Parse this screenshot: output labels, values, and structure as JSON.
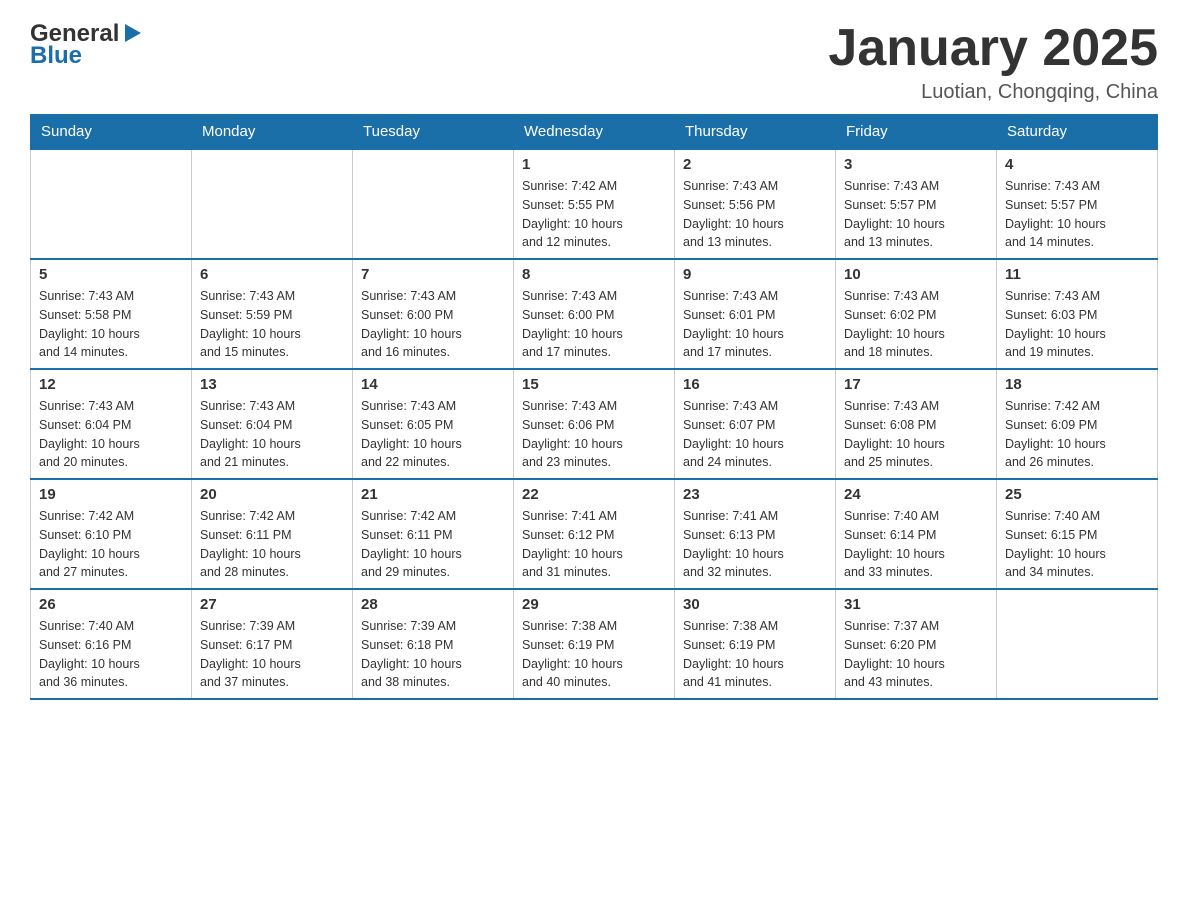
{
  "header": {
    "logo_general": "General",
    "logo_blue": "Blue",
    "month_title": "January 2025",
    "location": "Luotian, Chongqing, China"
  },
  "weekdays": [
    "Sunday",
    "Monday",
    "Tuesday",
    "Wednesday",
    "Thursday",
    "Friday",
    "Saturday"
  ],
  "weeks": [
    [
      {
        "day": "",
        "info": ""
      },
      {
        "day": "",
        "info": ""
      },
      {
        "day": "",
        "info": ""
      },
      {
        "day": "1",
        "info": "Sunrise: 7:42 AM\nSunset: 5:55 PM\nDaylight: 10 hours\nand 12 minutes."
      },
      {
        "day": "2",
        "info": "Sunrise: 7:43 AM\nSunset: 5:56 PM\nDaylight: 10 hours\nand 13 minutes."
      },
      {
        "day": "3",
        "info": "Sunrise: 7:43 AM\nSunset: 5:57 PM\nDaylight: 10 hours\nand 13 minutes."
      },
      {
        "day": "4",
        "info": "Sunrise: 7:43 AM\nSunset: 5:57 PM\nDaylight: 10 hours\nand 14 minutes."
      }
    ],
    [
      {
        "day": "5",
        "info": "Sunrise: 7:43 AM\nSunset: 5:58 PM\nDaylight: 10 hours\nand 14 minutes."
      },
      {
        "day": "6",
        "info": "Sunrise: 7:43 AM\nSunset: 5:59 PM\nDaylight: 10 hours\nand 15 minutes."
      },
      {
        "day": "7",
        "info": "Sunrise: 7:43 AM\nSunset: 6:00 PM\nDaylight: 10 hours\nand 16 minutes."
      },
      {
        "day": "8",
        "info": "Sunrise: 7:43 AM\nSunset: 6:00 PM\nDaylight: 10 hours\nand 17 minutes."
      },
      {
        "day": "9",
        "info": "Sunrise: 7:43 AM\nSunset: 6:01 PM\nDaylight: 10 hours\nand 17 minutes."
      },
      {
        "day": "10",
        "info": "Sunrise: 7:43 AM\nSunset: 6:02 PM\nDaylight: 10 hours\nand 18 minutes."
      },
      {
        "day": "11",
        "info": "Sunrise: 7:43 AM\nSunset: 6:03 PM\nDaylight: 10 hours\nand 19 minutes."
      }
    ],
    [
      {
        "day": "12",
        "info": "Sunrise: 7:43 AM\nSunset: 6:04 PM\nDaylight: 10 hours\nand 20 minutes."
      },
      {
        "day": "13",
        "info": "Sunrise: 7:43 AM\nSunset: 6:04 PM\nDaylight: 10 hours\nand 21 minutes."
      },
      {
        "day": "14",
        "info": "Sunrise: 7:43 AM\nSunset: 6:05 PM\nDaylight: 10 hours\nand 22 minutes."
      },
      {
        "day": "15",
        "info": "Sunrise: 7:43 AM\nSunset: 6:06 PM\nDaylight: 10 hours\nand 23 minutes."
      },
      {
        "day": "16",
        "info": "Sunrise: 7:43 AM\nSunset: 6:07 PM\nDaylight: 10 hours\nand 24 minutes."
      },
      {
        "day": "17",
        "info": "Sunrise: 7:43 AM\nSunset: 6:08 PM\nDaylight: 10 hours\nand 25 minutes."
      },
      {
        "day": "18",
        "info": "Sunrise: 7:42 AM\nSunset: 6:09 PM\nDaylight: 10 hours\nand 26 minutes."
      }
    ],
    [
      {
        "day": "19",
        "info": "Sunrise: 7:42 AM\nSunset: 6:10 PM\nDaylight: 10 hours\nand 27 minutes."
      },
      {
        "day": "20",
        "info": "Sunrise: 7:42 AM\nSunset: 6:11 PM\nDaylight: 10 hours\nand 28 minutes."
      },
      {
        "day": "21",
        "info": "Sunrise: 7:42 AM\nSunset: 6:11 PM\nDaylight: 10 hours\nand 29 minutes."
      },
      {
        "day": "22",
        "info": "Sunrise: 7:41 AM\nSunset: 6:12 PM\nDaylight: 10 hours\nand 31 minutes."
      },
      {
        "day": "23",
        "info": "Sunrise: 7:41 AM\nSunset: 6:13 PM\nDaylight: 10 hours\nand 32 minutes."
      },
      {
        "day": "24",
        "info": "Sunrise: 7:40 AM\nSunset: 6:14 PM\nDaylight: 10 hours\nand 33 minutes."
      },
      {
        "day": "25",
        "info": "Sunrise: 7:40 AM\nSunset: 6:15 PM\nDaylight: 10 hours\nand 34 minutes."
      }
    ],
    [
      {
        "day": "26",
        "info": "Sunrise: 7:40 AM\nSunset: 6:16 PM\nDaylight: 10 hours\nand 36 minutes."
      },
      {
        "day": "27",
        "info": "Sunrise: 7:39 AM\nSunset: 6:17 PM\nDaylight: 10 hours\nand 37 minutes."
      },
      {
        "day": "28",
        "info": "Sunrise: 7:39 AM\nSunset: 6:18 PM\nDaylight: 10 hours\nand 38 minutes."
      },
      {
        "day": "29",
        "info": "Sunrise: 7:38 AM\nSunset: 6:19 PM\nDaylight: 10 hours\nand 40 minutes."
      },
      {
        "day": "30",
        "info": "Sunrise: 7:38 AM\nSunset: 6:19 PM\nDaylight: 10 hours\nand 41 minutes."
      },
      {
        "day": "31",
        "info": "Sunrise: 7:37 AM\nSunset: 6:20 PM\nDaylight: 10 hours\nand 43 minutes."
      },
      {
        "day": "",
        "info": ""
      }
    ]
  ]
}
